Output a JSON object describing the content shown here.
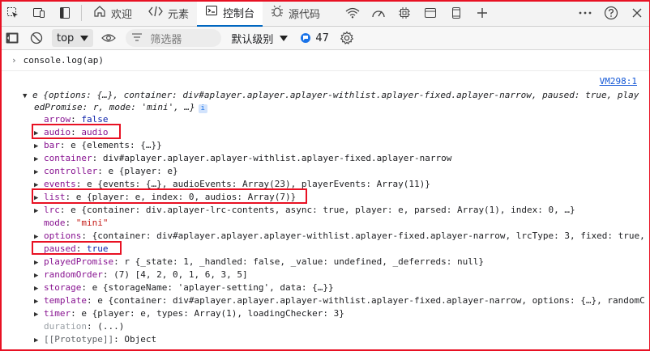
{
  "tabbar": {
    "welcome": "欢迎",
    "elements": "元素",
    "console": "控制台",
    "sources": "源代码"
  },
  "toolbar": {
    "context": "top",
    "filter_placeholder": "筛选器",
    "level": "默认级别",
    "issue_count": "47"
  },
  "console": {
    "command": "console.log(ap)",
    "source_link": "VM298:1",
    "summary_1": "e {options: {…}, container: div#aplayer.aplayer.aplayer-withlist.aplayer-fixed.aplayer-narrow, paused: true, play",
    "summary_2": "edPromise: r, mode: 'mini', …}",
    "props": [
      {
        "key": "arrow",
        "value": "false",
        "expandable": false
      },
      {
        "key": "audio",
        "value": "audio",
        "expandable": true
      },
      {
        "key": "bar",
        "value": "e {elements: {…}}",
        "expandable": true
      },
      {
        "key": "container",
        "value": "div#aplayer.aplayer.aplayer-withlist.aplayer-fixed.aplayer-narrow",
        "expandable": true
      },
      {
        "key": "controller",
        "value": "e {player: e}",
        "expandable": true
      },
      {
        "key": "events",
        "value": "e {events: {…}, audioEvents: Array(23), playerEvents: Array(11)}",
        "expandable": true
      },
      {
        "key": "list",
        "value": "e {player: e, index: 0, audios: Array(7)}",
        "expandable": true
      },
      {
        "key": "lrc",
        "value": "e {container: div.aplayer-lrc-contents, async: true, player: e, parsed: Array(1), index: 0, …}",
        "expandable": true
      },
      {
        "key": "mode",
        "value": "\"mini\"",
        "expandable": false
      },
      {
        "key": "options",
        "value": "{container: div#aplayer.aplayer.aplayer-withlist.aplayer-fixed.aplayer-narrow, lrcType: 3, fixed: true,",
        "expandable": true
      },
      {
        "key": "paused",
        "value": "true",
        "expandable": false
      },
      {
        "key": "playedPromise",
        "value": "r {_state: 1, _handled: false, _value: undefined, _deferreds: null}",
        "expandable": true
      },
      {
        "key": "randomOrder",
        "value": "(7) [4, 2, 0, 1, 6, 3, 5]",
        "expandable": true
      },
      {
        "key": "storage",
        "value": "e {storageName: 'aplayer-setting', data: {…}}",
        "expandable": true
      },
      {
        "key": "template",
        "value": "e {container: div#aplayer.aplayer.aplayer-withlist.aplayer-fixed.aplayer-narrow, options: {…}, randomC",
        "expandable": true
      },
      {
        "key": "timer",
        "value": "e {player: e, types: Array(1), loadingChecker: 3}",
        "expandable": true
      },
      {
        "key": "duration",
        "value": "(...)",
        "expandable": false,
        "getter": true
      },
      {
        "key": "[[Prototype]]",
        "value": "Object",
        "expandable": true,
        "proto": true
      }
    ]
  },
  "colors": {
    "accent": "#0067c0",
    "highlight": "#e81123",
    "key": "#881391",
    "string": "#c41a16",
    "number": "#1a1aa6"
  }
}
